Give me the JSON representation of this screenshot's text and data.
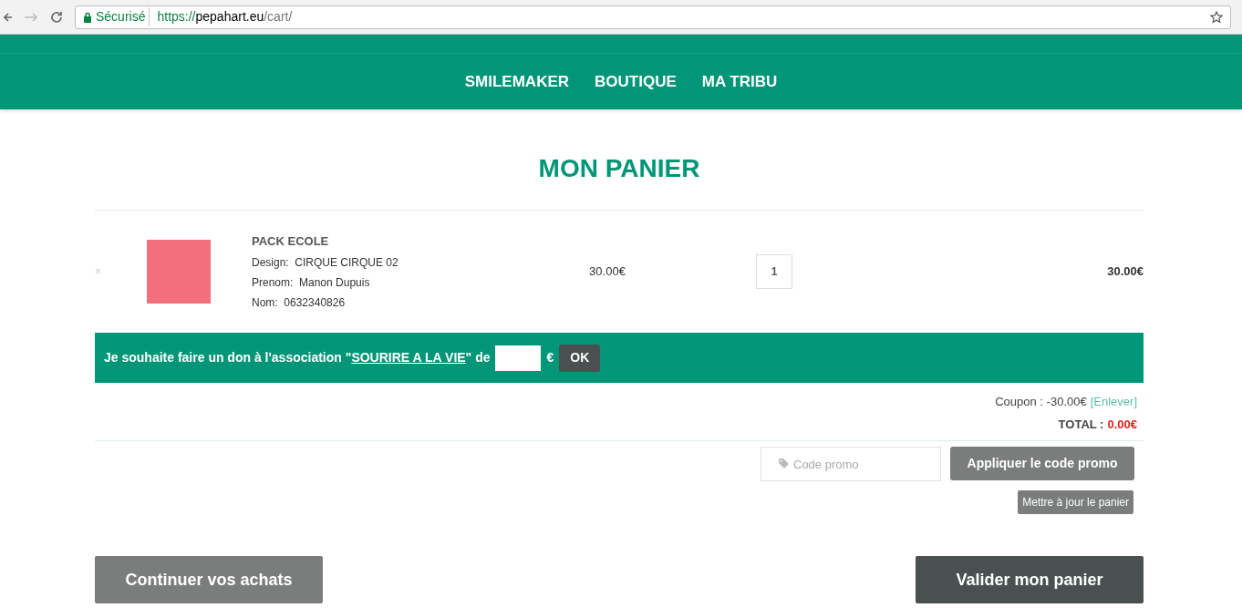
{
  "browser": {
    "secure_label": "Sécurisé",
    "url_scheme": "https://",
    "url_host": "pepahart.eu",
    "url_path": "/cart/"
  },
  "nav": [
    "SMILEMAKER",
    "BOUTIQUE",
    "MA TRIBU"
  ],
  "title": "MON PANIER",
  "cart_items": [
    {
      "remove": "×",
      "name": "PACK ECOLE",
      "attributes": [
        {
          "label": "Design:",
          "value": "CIRQUE CIRQUE 02"
        },
        {
          "label": "Prenom:",
          "value": "Manon Dupuis"
        },
        {
          "label": "Nom:",
          "value": "0632340826"
        }
      ],
      "price": "30.00€",
      "quantity": "1",
      "subtotal": "30.00€"
    }
  ],
  "donation": {
    "text_before": "Je souhaite faire un don à l'association \"",
    "link": "SOURIRE A LA VIE",
    "text_after": "\" de",
    "currency": "€",
    "button": "OK"
  },
  "coupon": {
    "label": "Coupon : -30.00€",
    "remove_link": "[Enlever]"
  },
  "total": {
    "label": "TOTAL :",
    "value": "0.00€"
  },
  "promo": {
    "placeholder": "Code promo",
    "apply_button": "Appliquer le code promo",
    "update_button": "Mettre à jour le panier"
  },
  "actions": {
    "continue": "Continuer vos achats",
    "checkout": "Valider mon panier"
  }
}
